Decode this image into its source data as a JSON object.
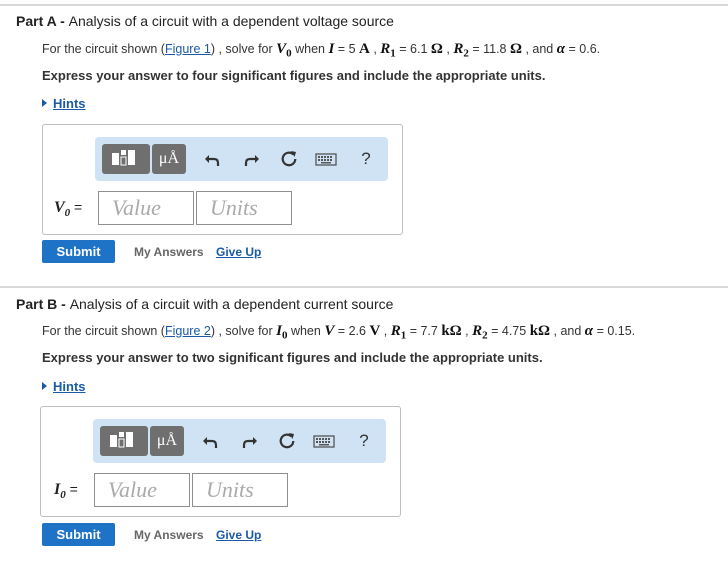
{
  "partA": {
    "part_label": "Part A - ",
    "title": "Analysis of a circuit with a dependent voltage source",
    "q_pre": "For the circuit shown (",
    "figure_link": "Figure 1",
    "q_solve": ") , solve for ",
    "target_sym": "V",
    "target_sub": "0",
    "q_when": " when ",
    "v1_sym": "I",
    "v1_val": " = 5 ",
    "v1_unit": "A",
    "r1_sym": "R",
    "r1_sub": "1",
    "r1_val": " = 6.1 ",
    "r1_unit": "Ω",
    "r2_sym": "R",
    "r2_sub": "2",
    "r2_val": " = 11.8 ",
    "r2_unit": "Ω",
    "sep": " , ",
    "and_text": " , and ",
    "alpha_sym": "α",
    "alpha_val": " = 0.6.",
    "instruction": "Express your answer to four significant figures and include the appropriate units.",
    "hints": "Hints",
    "var_label": "V",
    "var_sub": "0",
    "var_eq": " =",
    "value_placeholder": "Value",
    "units_placeholder": "Units",
    "submit": "Submit",
    "my_answers": "My Answers",
    "give_up": "Give Up"
  },
  "partB": {
    "part_label": "Part B - ",
    "title": "Analysis of a circuit with a dependent current source",
    "q_pre": "For the circuit shown (",
    "figure_link": "Figure 2",
    "q_solve": ") , solve for ",
    "target_sym": "I",
    "target_sub": "0",
    "q_when": " when ",
    "v1_sym": "V",
    "v1_val": " = 2.6 ",
    "v1_unit": "V",
    "r1_sym": "R",
    "r1_sub": "1",
    "r1_val": " = 7.7 ",
    "r1_unit": "kΩ",
    "r2_sym": "R",
    "r2_sub": "2",
    "r2_val": " = 4.75 ",
    "r2_unit": "kΩ",
    "sep": " , ",
    "and_text": " , and ",
    "alpha_sym": "α",
    "alpha_val": " = 0.15.",
    "instruction": "Express your answer to two significant figures and include the appropriate units.",
    "hints": "Hints",
    "var_label": "I",
    "var_sub": "0",
    "var_eq": " =",
    "value_placeholder": "Value",
    "units_placeholder": "Units",
    "submit": "Submit",
    "my_answers": "My Answers",
    "give_up": "Give Up"
  },
  "toolbar": {
    "mu_label": "μÅ",
    "help_label": "?",
    "icons": [
      "templates-icon",
      "units-mu-icon",
      "undo-icon",
      "redo-icon",
      "reset-icon",
      "keyboard-icon",
      "help-icon"
    ]
  },
  "colors": {
    "accent": "#1f73c7",
    "link": "#1a5aa6",
    "toolbar_bg": "#cfe3f5",
    "toolbar_btn": "#6f6f6f"
  }
}
